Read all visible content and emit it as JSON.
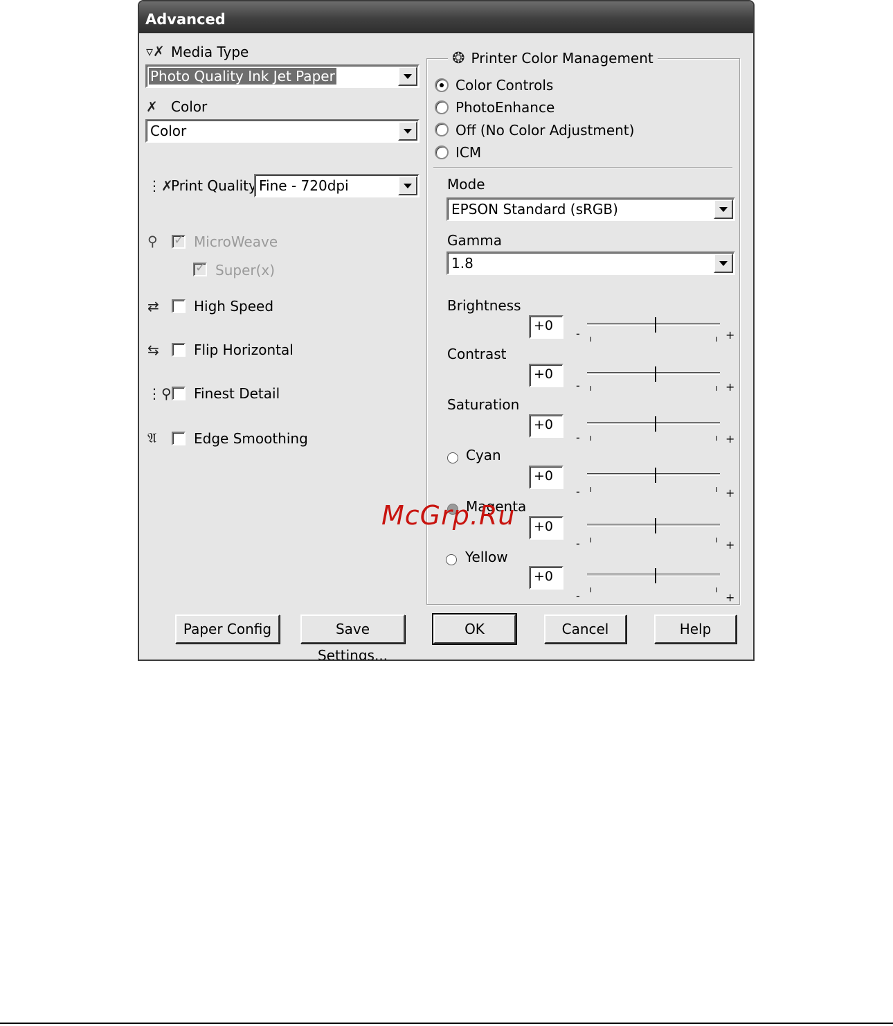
{
  "window": {
    "title": "Advanced"
  },
  "left": {
    "media_type": {
      "label": "Media Type",
      "value": "Photo Quality Ink Jet Paper"
    },
    "color": {
      "label": "Color",
      "value": "Color"
    },
    "print_quality": {
      "label": "Print Quality",
      "value": "Fine - 720dpi"
    },
    "options": {
      "microweave": {
        "label": "MicroWeave",
        "checked": true,
        "enabled": false
      },
      "super": {
        "label": "Super(x)",
        "checked": true,
        "enabled": false
      },
      "high_speed": {
        "label": "High Speed",
        "checked": false
      },
      "flip_horizontal": {
        "label": "Flip Horizontal",
        "checked": false
      },
      "finest_detail": {
        "label": "Finest Detail",
        "checked": false
      },
      "edge_smoothing": {
        "label": "Edge Smoothing",
        "checked": false
      }
    }
  },
  "color_management": {
    "title": "Printer Color Management",
    "radios": [
      {
        "label": "Color Controls",
        "selected": true
      },
      {
        "label": "PhotoEnhance",
        "selected": false
      },
      {
        "label": "Off (No Color Adjustment)",
        "selected": false
      },
      {
        "label": "ICM",
        "selected": false
      }
    ],
    "mode": {
      "label": "Mode",
      "value": "EPSON Standard (sRGB)"
    },
    "gamma": {
      "label": "Gamma",
      "value": "1.8"
    },
    "sliders": [
      {
        "label": "Brightness",
        "value": "+0"
      },
      {
        "label": "Contrast",
        "value": "+0"
      },
      {
        "label": "Saturation",
        "value": "+0"
      },
      {
        "label": "Cyan",
        "value": "+0"
      },
      {
        "label": "Magenta",
        "value": "+0"
      },
      {
        "label": "Yellow",
        "value": "+0"
      }
    ],
    "minus": "-",
    "plus": "+"
  },
  "buttons": {
    "paper_config": "Paper Config",
    "save_settings": "Save Settings...",
    "ok": "OK",
    "cancel": "Cancel",
    "help": "Help"
  },
  "watermark": "McGrp.Ru"
}
